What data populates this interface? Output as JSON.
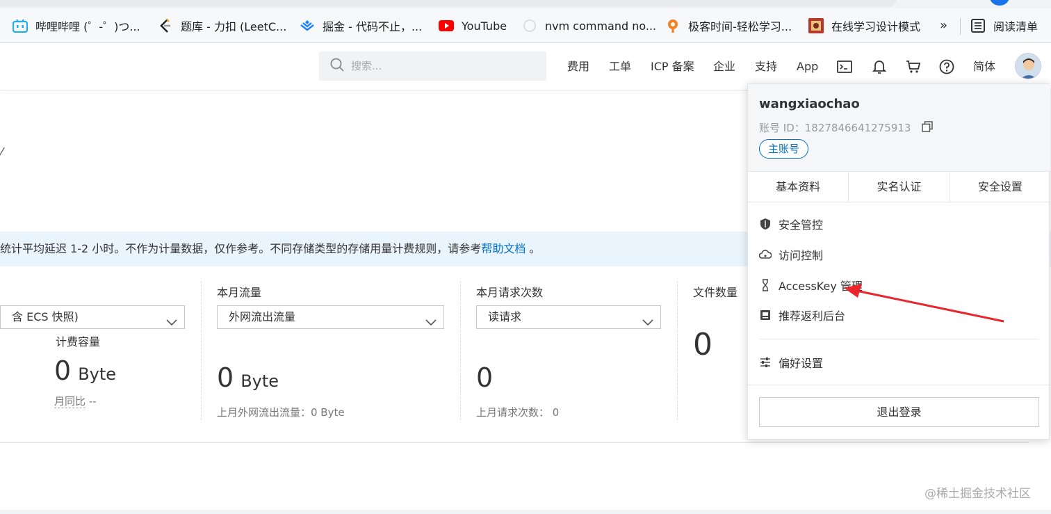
{
  "bookmarks": [
    {
      "label": "哔哩哔哩 (゜-゜)つ...",
      "icon": "bilibili-icon"
    },
    {
      "label": "题库 - 力扣 (LeetC...",
      "icon": "leetcode-icon"
    },
    {
      "label": "掘金 - 代码不止，...",
      "icon": "juejin-icon"
    },
    {
      "label": "YouTube",
      "icon": "youtube-icon"
    },
    {
      "label": "nvm command no...",
      "icon": "github-icon"
    },
    {
      "label": "极客时间-轻松学习...",
      "icon": "geekbang-icon"
    },
    {
      "label": "在线学习设计模式",
      "icon": "refactoring-icon"
    }
  ],
  "bookmarks_more": "»",
  "reading_list": "阅读清单",
  "topnav": {
    "search_placeholder": "搜索...",
    "items": [
      "费用",
      "工单",
      "ICP 备案",
      "企业",
      "支持",
      "App"
    ],
    "lang": "简体"
  },
  "notice": {
    "text": "统计平均延迟 1-2 小时。不作为计量数据，仅作参考。不同存储类型的存储用量计费规则，请参考",
    "link": "帮助文档",
    "tail": " 。"
  },
  "stats": [
    {
      "title": "",
      "select": "含 ECS 快照)",
      "sublabel": "计费容量",
      "value": "0",
      "unit": "Byte",
      "footer_label": "月同比",
      "footer_value": "--"
    },
    {
      "title": "本月流量",
      "select": "外网流出流量",
      "value": "0",
      "unit": "Byte",
      "footer": "上月外网流出流量：0 Byte"
    },
    {
      "title": "本月请求次数",
      "select": "读请求",
      "value": "0",
      "footer": "上月请求次数： 0"
    },
    {
      "title": "文件数量",
      "value": "0"
    }
  ],
  "account_panel": {
    "username": "wangxiaochao",
    "account_id_label": "账号 ID：",
    "account_id": "1827846641275913",
    "badge": "主账号",
    "tabs": [
      "基本资料",
      "实名认证",
      "安全设置"
    ],
    "menu": [
      {
        "label": "安全管控",
        "icon": "shield-icon"
      },
      {
        "label": "访问控制",
        "icon": "cloud-icon"
      },
      {
        "label": "AccessKey 管理",
        "icon": "key-icon"
      },
      {
        "label": "推荐返利后台",
        "icon": "gift-icon"
      },
      {
        "label": "偏好设置",
        "icon": "sliders-icon"
      }
    ],
    "logout": "退出登录"
  },
  "watermark": "@稀土掘金技术社区",
  "colors": {
    "accent": "#0070cc",
    "arrow": "#e8262b",
    "notice_bg": "#eaf4fd"
  }
}
